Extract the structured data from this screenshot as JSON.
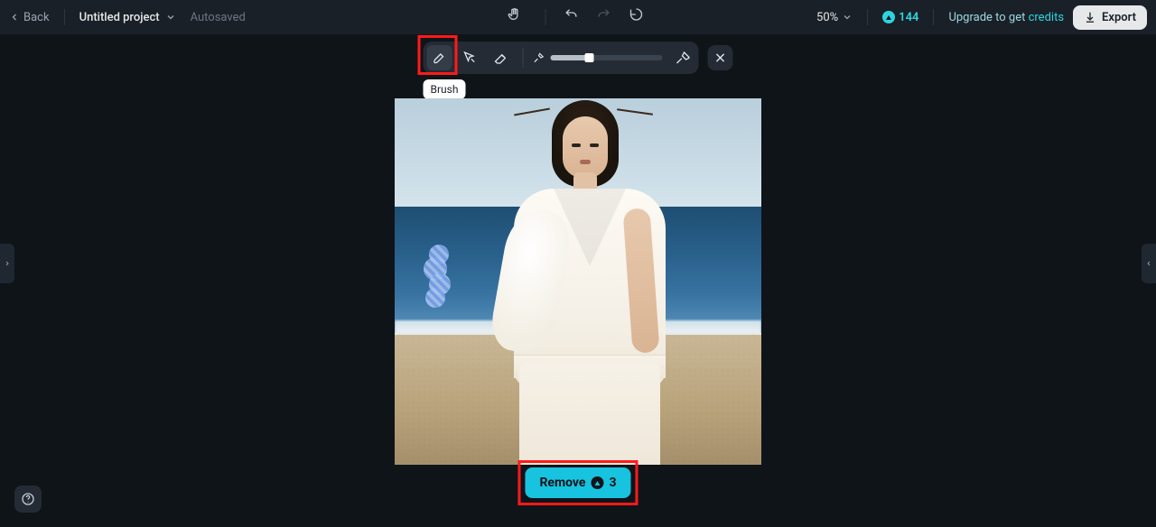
{
  "colors": {
    "accent": "#18c3df",
    "highlight": "#ff1a1a"
  },
  "topbar": {
    "back_label": "Back",
    "project_title": "Untitled project",
    "autosaved_label": "Autosaved",
    "zoom_label": "50%",
    "credits_count": "144",
    "upgrade_lead": "Upgrade to get ",
    "upgrade_credits_word": "credits",
    "export_label": "Export"
  },
  "tool_palette": {
    "tooltip_brush": "Brush",
    "tools": {
      "brush": "brush",
      "auto_select": "auto-select",
      "eraser": "eraser"
    },
    "slider_percent": 35
  },
  "actions": {
    "remove_label": "Remove",
    "remove_cost": "3"
  },
  "highlights": {
    "brush_tool": true,
    "remove_button": true
  }
}
